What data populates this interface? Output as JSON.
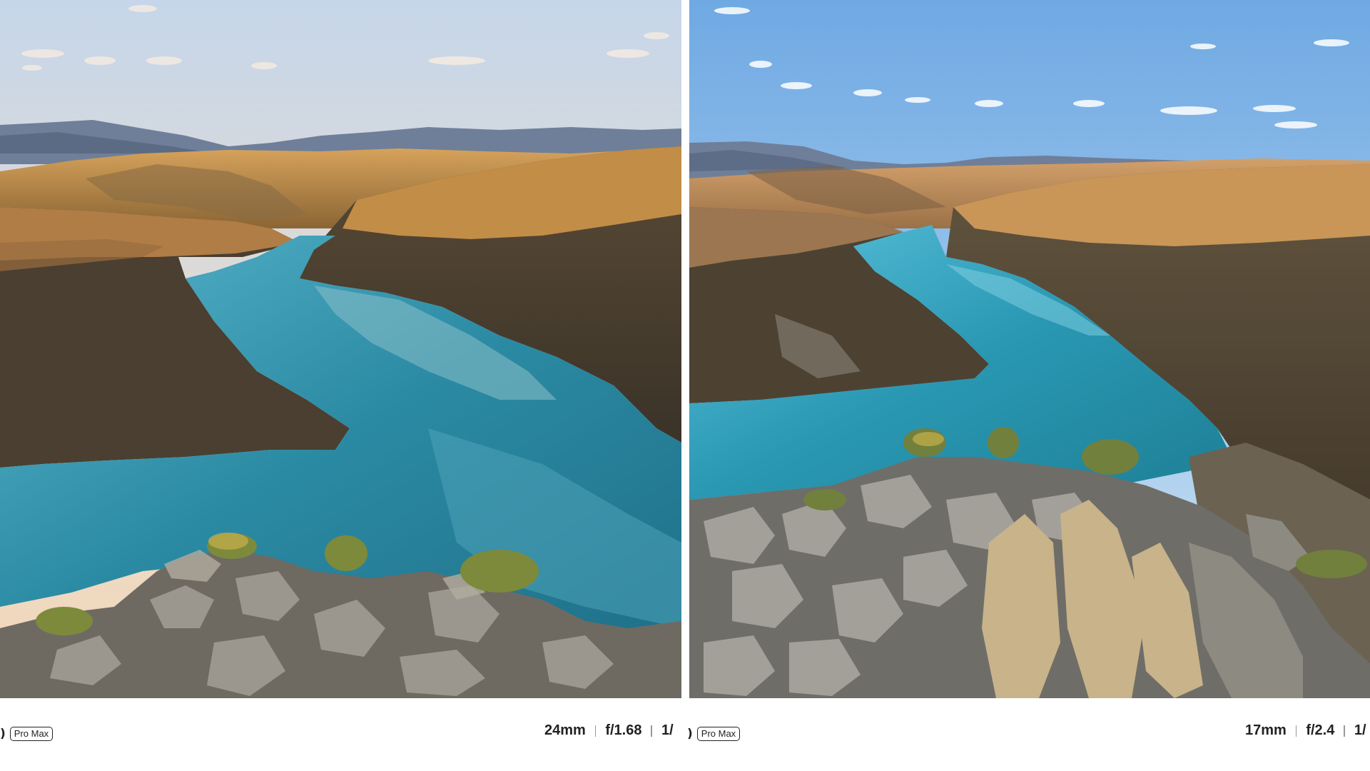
{
  "left_photo": {
    "icon": "camera-mark-icon",
    "glyph": ")",
    "badge": "Pro Max",
    "focal_length": "24mm",
    "aperture": "f/1.68",
    "shutter": "1/"
  },
  "right_photo": {
    "icon": "camera-mark-icon",
    "glyph": ")",
    "badge": "Pro Max",
    "focal_length": "17mm",
    "aperture": "f/2.4",
    "shutter": "1/"
  },
  "colors": {
    "sky_top": "#c9d8ea",
    "sky_bottom_warm": "#f3dcc0",
    "sky_right_top": "#7fb3e6",
    "water": "#2f8fa8",
    "water_light": "#6cc3d8",
    "hill_sunlit": "#c7954f",
    "hill_shadow": "#4b4133",
    "rock": "#8c8a86"
  }
}
